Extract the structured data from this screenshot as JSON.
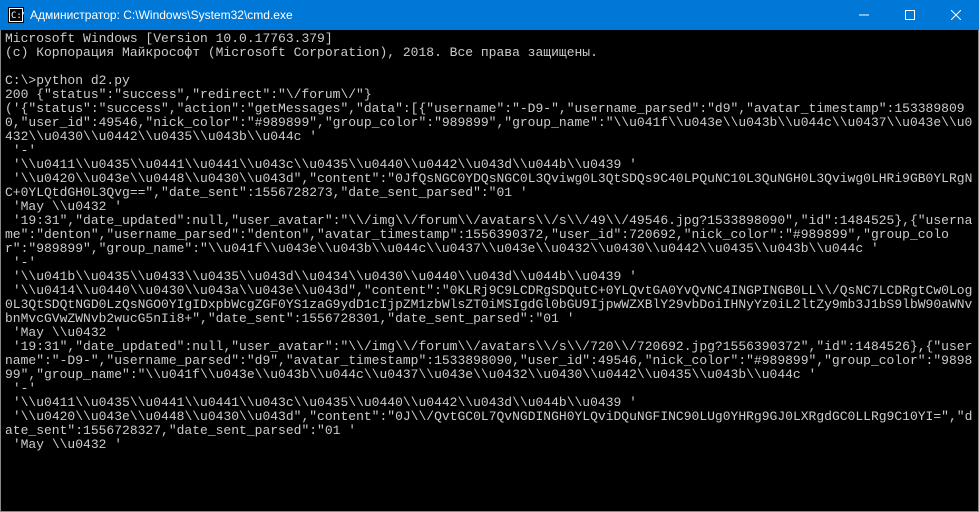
{
  "window": {
    "title": "Администратор: C:\\Windows\\System32\\cmd.exe"
  },
  "console": {
    "line0": "Microsoft Windows [Version 10.0.17763.379]",
    "line1": "(c) Корпорация Майкрософт (Microsoft Corporation), 2018. Все права защищены.",
    "blank1": "",
    "prompt_cmd": "C:\\>python d2.py",
    "out1": "200 {\"status\":\"success\",\"redirect\":\"\\/forum\\/\"}",
    "out2": "('{\"status\":\"success\",\"action\":\"getMessages\",\"data\":[{\"username\":\"-D9-\",\"username_parsed\":\"d9\",\"avatar_timestamp\":1533898090,\"user_id\":49546,\"nick_color\":\"#989899\",\"group_color\":\"989899\",\"group_name\":\"\\\\u041f\\\\u043e\\\\u043b\\\\u044c\\\\u0437\\\\u043e\\\\u0432\\\\u0430\\\\u0442\\\\u0435\\\\u043b\\\\u044c '",
    "out3": " '-'",
    "out4": " '\\\\u0411\\\\u0435\\\\u0441\\\\u0441\\\\u043c\\\\u0435\\\\u0440\\\\u0442\\\\u043d\\\\u044b\\\\u0439 '",
    "out5": " '\\\\u0420\\\\u043e\\\\u0448\\\\u0430\\\\u043d\",\"content\":\"0JfQsNGC0YDQsNGC0L3Qviwg0L3QtSDQs9C40LPQuNC10L3QuNGH0L3Qviwg0LHRi9GB0YLRgNC+0YLQtdGH0L3Qvg==\",\"date_sent\":1556728273,\"date_sent_parsed\":\"01 '",
    "out6": " 'May \\\\u0432 '",
    "out7": " '19:31\",\"date_updated\":null,\"user_avatar\":\"\\\\/img\\\\/forum\\\\/avatars\\\\/s\\\\/49\\\\/49546.jpg?1533898090\",\"id\":1484525},{\"username\":\"denton\",\"username_parsed\":\"denton\",\"avatar_timestamp\":1556390372,\"user_id\":720692,\"nick_color\":\"#989899\",\"group_color\":\"989899\",\"group_name\":\"\\\\u041f\\\\u043e\\\\u043b\\\\u044c\\\\u0437\\\\u043e\\\\u0432\\\\u0430\\\\u0442\\\\u0435\\\\u043b\\\\u044c '",
    "out8": " '-'",
    "out9": " '\\\\u041b\\\\u0435\\\\u0433\\\\u0435\\\\u043d\\\\u0434\\\\u0430\\\\u0440\\\\u043d\\\\u044b\\\\u0439 '",
    "out10": " '\\\\u0414\\\\u0440\\\\u0430\\\\u043a\\\\u043e\\\\u043d\",\"content\":\"0KLRj9C9LCDRgSDQutC+0YLQvtGA0YvQvNC4INGPINGB0LL\\\\/QsNC7LCDRgtCw0Log0L3QtSDQtNGD0LzQsNGO0YIgIDxpbWcgZGF0YS1zaG9ydD1cIjpZM1zbWlsZT0iMSIgdGl0bGU9IjpwWZXBlY29vbDoiIHNyYz0iL2ltZy9mb3J1bS9lbW90aWNvbnMvcGVwZWNvb2wucG5nIi8+\",\"date_sent\":1556728301,\"date_sent_parsed\":\"01 '",
    "out11": " 'May \\\\u0432 '",
    "out12": " '19:31\",\"date_updated\":null,\"user_avatar\":\"\\\\/img\\\\/forum\\\\/avatars\\\\/s\\\\/720\\\\/720692.jpg?1556390372\",\"id\":1484526},{\"username\":\"-D9-\",\"username_parsed\":\"d9\",\"avatar_timestamp\":1533898090,\"user_id\":49546,\"nick_color\":\"#989899\",\"group_color\":\"989899\",\"group_name\":\"\\\\u041f\\\\u043e\\\\u043b\\\\u044c\\\\u0437\\\\u043e\\\\u0432\\\\u0430\\\\u0442\\\\u0435\\\\u043b\\\\u044c '",
    "out13": " '-'",
    "out14": " '\\\\u0411\\\\u0435\\\\u0441\\\\u0441\\\\u043c\\\\u0435\\\\u0440\\\\u0442\\\\u043d\\\\u044b\\\\u0439 '",
    "out15": " '\\\\u0420\\\\u043e\\\\u0448\\\\u0430\\\\u043d\",\"content\":\"0J\\\\/QvtGC0L7QvNGDINGH0YLQviDQuNGFINC90LUg0YHRg9GJ0LXRgdGC0LLRg9C10YI=\",\"date_sent\":1556728327,\"date_sent_parsed\":\"01 '",
    "out16": " 'May \\\\u0432 '"
  }
}
